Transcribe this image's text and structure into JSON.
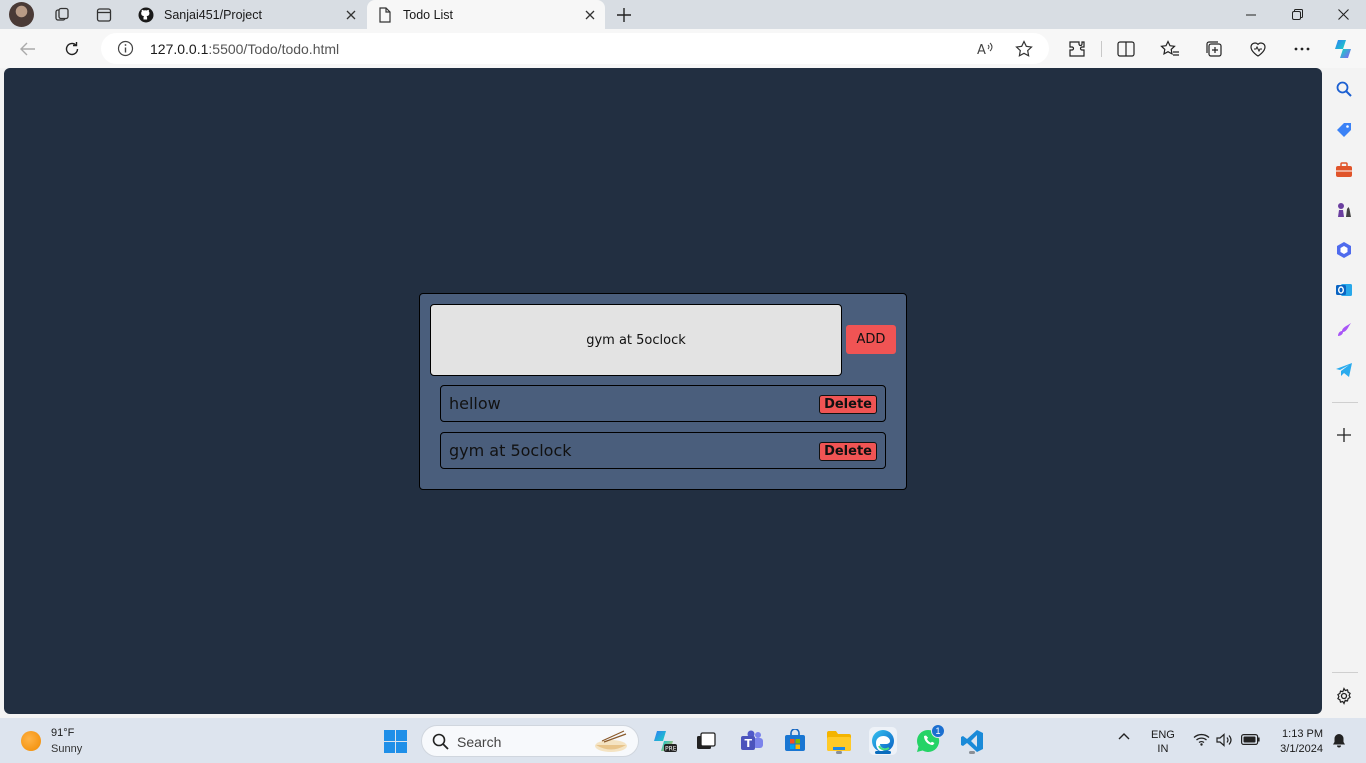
{
  "browser": {
    "tabs": [
      {
        "title": "Sanjai451/Project",
        "active": false
      },
      {
        "title": "Todo List",
        "active": true
      }
    ],
    "address": {
      "host": "127.0.0.1",
      "path": ":5500/Todo/todo.html"
    }
  },
  "todo": {
    "input_value": "gym at 5oclock",
    "add_label": "ADD",
    "items": [
      {
        "text": "hellow",
        "delete_label": "Delete"
      },
      {
        "text": "gym at 5oclock",
        "delete_label": "Delete"
      }
    ]
  },
  "taskbar": {
    "weather": {
      "temp": "91°F",
      "desc": "Sunny"
    },
    "search_label": "Search",
    "lang": {
      "line1": "ENG",
      "line2": "IN"
    },
    "clock": {
      "time": "1:13 PM",
      "date": "3/1/2024"
    },
    "whatsapp_badge": "1"
  },
  "colors": {
    "page_bg": "#222f41",
    "card_bg": "#4a5e7c",
    "accent_red": "#f05454",
    "input_bg": "#e3e3e3"
  }
}
